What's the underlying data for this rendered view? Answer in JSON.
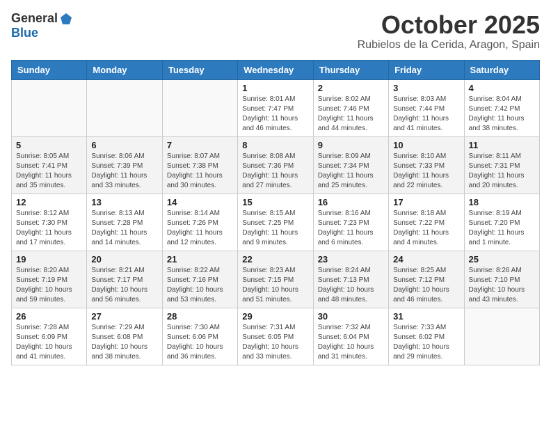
{
  "header": {
    "logo_line1": "General",
    "logo_line2": "Blue",
    "month": "October 2025",
    "location": "Rubielos de la Cerida, Aragon, Spain"
  },
  "weekdays": [
    "Sunday",
    "Monday",
    "Tuesday",
    "Wednesday",
    "Thursday",
    "Friday",
    "Saturday"
  ],
  "weeks": [
    [
      {
        "day": "",
        "info": ""
      },
      {
        "day": "",
        "info": ""
      },
      {
        "day": "",
        "info": ""
      },
      {
        "day": "1",
        "info": "Sunrise: 8:01 AM\nSunset: 7:47 PM\nDaylight: 11 hours\nand 46 minutes."
      },
      {
        "day": "2",
        "info": "Sunrise: 8:02 AM\nSunset: 7:46 PM\nDaylight: 11 hours\nand 44 minutes."
      },
      {
        "day": "3",
        "info": "Sunrise: 8:03 AM\nSunset: 7:44 PM\nDaylight: 11 hours\nand 41 minutes."
      },
      {
        "day": "4",
        "info": "Sunrise: 8:04 AM\nSunset: 7:42 PM\nDaylight: 11 hours\nand 38 minutes."
      }
    ],
    [
      {
        "day": "5",
        "info": "Sunrise: 8:05 AM\nSunset: 7:41 PM\nDaylight: 11 hours\nand 35 minutes."
      },
      {
        "day": "6",
        "info": "Sunrise: 8:06 AM\nSunset: 7:39 PM\nDaylight: 11 hours\nand 33 minutes."
      },
      {
        "day": "7",
        "info": "Sunrise: 8:07 AM\nSunset: 7:38 PM\nDaylight: 11 hours\nand 30 minutes."
      },
      {
        "day": "8",
        "info": "Sunrise: 8:08 AM\nSunset: 7:36 PM\nDaylight: 11 hours\nand 27 minutes."
      },
      {
        "day": "9",
        "info": "Sunrise: 8:09 AM\nSunset: 7:34 PM\nDaylight: 11 hours\nand 25 minutes."
      },
      {
        "day": "10",
        "info": "Sunrise: 8:10 AM\nSunset: 7:33 PM\nDaylight: 11 hours\nand 22 minutes."
      },
      {
        "day": "11",
        "info": "Sunrise: 8:11 AM\nSunset: 7:31 PM\nDaylight: 11 hours\nand 20 minutes."
      }
    ],
    [
      {
        "day": "12",
        "info": "Sunrise: 8:12 AM\nSunset: 7:30 PM\nDaylight: 11 hours\nand 17 minutes."
      },
      {
        "day": "13",
        "info": "Sunrise: 8:13 AM\nSunset: 7:28 PM\nDaylight: 11 hours\nand 14 minutes."
      },
      {
        "day": "14",
        "info": "Sunrise: 8:14 AM\nSunset: 7:26 PM\nDaylight: 11 hours\nand 12 minutes."
      },
      {
        "day": "15",
        "info": "Sunrise: 8:15 AM\nSunset: 7:25 PM\nDaylight: 11 hours\nand 9 minutes."
      },
      {
        "day": "16",
        "info": "Sunrise: 8:16 AM\nSunset: 7:23 PM\nDaylight: 11 hours\nand 6 minutes."
      },
      {
        "day": "17",
        "info": "Sunrise: 8:18 AM\nSunset: 7:22 PM\nDaylight: 11 hours\nand 4 minutes."
      },
      {
        "day": "18",
        "info": "Sunrise: 8:19 AM\nSunset: 7:20 PM\nDaylight: 11 hours\nand 1 minute."
      }
    ],
    [
      {
        "day": "19",
        "info": "Sunrise: 8:20 AM\nSunset: 7:19 PM\nDaylight: 10 hours\nand 59 minutes."
      },
      {
        "day": "20",
        "info": "Sunrise: 8:21 AM\nSunset: 7:17 PM\nDaylight: 10 hours\nand 56 minutes."
      },
      {
        "day": "21",
        "info": "Sunrise: 8:22 AM\nSunset: 7:16 PM\nDaylight: 10 hours\nand 53 minutes."
      },
      {
        "day": "22",
        "info": "Sunrise: 8:23 AM\nSunset: 7:15 PM\nDaylight: 10 hours\nand 51 minutes."
      },
      {
        "day": "23",
        "info": "Sunrise: 8:24 AM\nSunset: 7:13 PM\nDaylight: 10 hours\nand 48 minutes."
      },
      {
        "day": "24",
        "info": "Sunrise: 8:25 AM\nSunset: 7:12 PM\nDaylight: 10 hours\nand 46 minutes."
      },
      {
        "day": "25",
        "info": "Sunrise: 8:26 AM\nSunset: 7:10 PM\nDaylight: 10 hours\nand 43 minutes."
      }
    ],
    [
      {
        "day": "26",
        "info": "Sunrise: 7:28 AM\nSunset: 6:09 PM\nDaylight: 10 hours\nand 41 minutes."
      },
      {
        "day": "27",
        "info": "Sunrise: 7:29 AM\nSunset: 6:08 PM\nDaylight: 10 hours\nand 38 minutes."
      },
      {
        "day": "28",
        "info": "Sunrise: 7:30 AM\nSunset: 6:06 PM\nDaylight: 10 hours\nand 36 minutes."
      },
      {
        "day": "29",
        "info": "Sunrise: 7:31 AM\nSunset: 6:05 PM\nDaylight: 10 hours\nand 33 minutes."
      },
      {
        "day": "30",
        "info": "Sunrise: 7:32 AM\nSunset: 6:04 PM\nDaylight: 10 hours\nand 31 minutes."
      },
      {
        "day": "31",
        "info": "Sunrise: 7:33 AM\nSunset: 6:02 PM\nDaylight: 10 hours\nand 29 minutes."
      },
      {
        "day": "",
        "info": ""
      }
    ]
  ]
}
